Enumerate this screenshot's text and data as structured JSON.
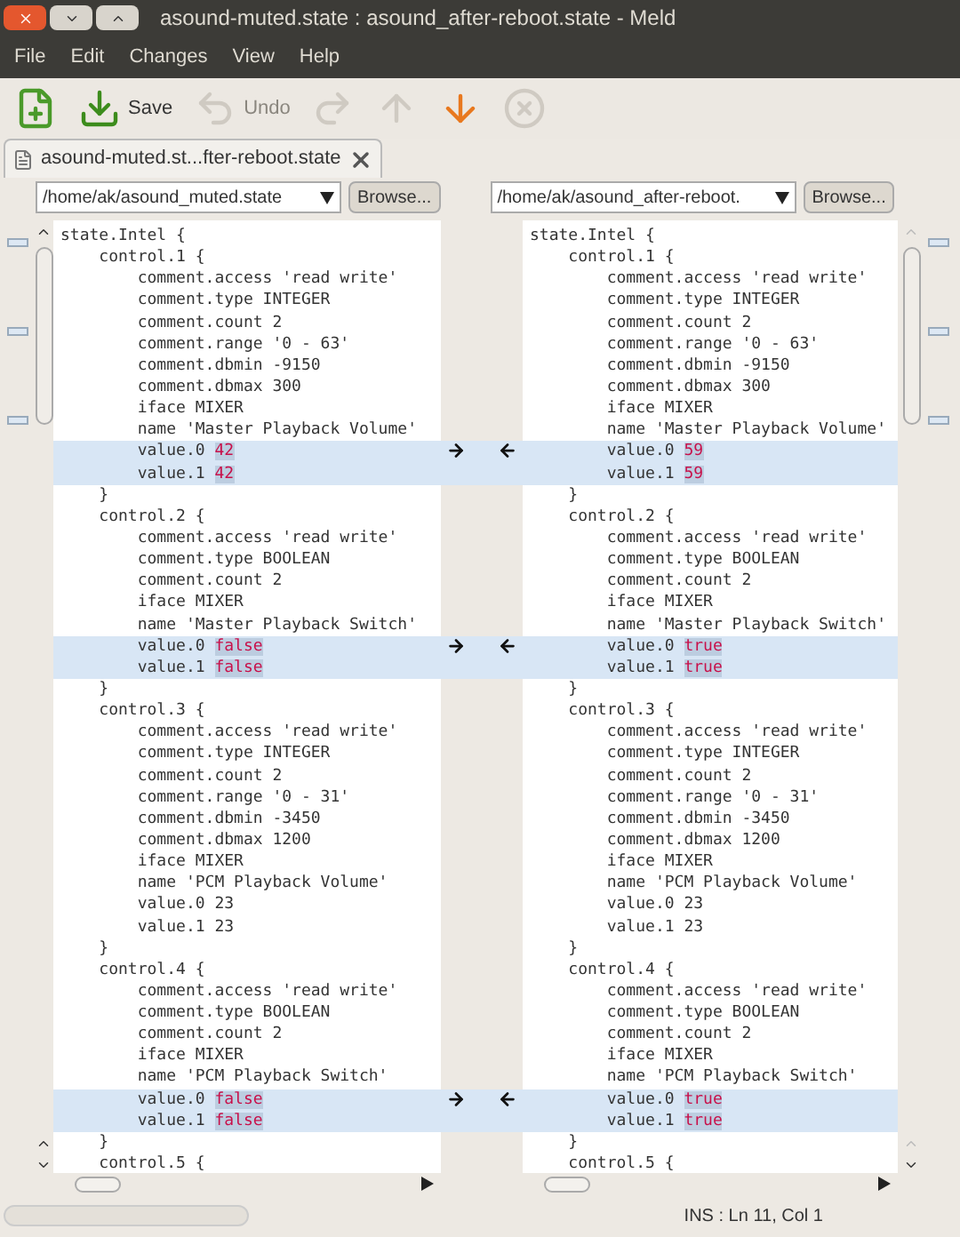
{
  "window": {
    "title": "asound-muted.state : asound_after-reboot.state - Meld"
  },
  "menu": [
    "File",
    "Edit",
    "Changes",
    "View",
    "Help"
  ],
  "toolbar": [
    {
      "kind": "new",
      "disabled": false
    },
    {
      "kind": "save",
      "label": "Save",
      "disabled": false
    },
    {
      "kind": "undo",
      "label": "Undo",
      "disabled": true
    },
    {
      "kind": "redo",
      "disabled": true
    },
    {
      "kind": "up",
      "disabled": true
    },
    {
      "kind": "down",
      "disabled": false
    },
    {
      "kind": "stop",
      "disabled": true
    }
  ],
  "tab": {
    "label": "asound-muted.st...fter-reboot.state"
  },
  "panes": [
    {
      "path": "/home/ak/asound_muted.state",
      "browse": "Browse...",
      "lines": [
        {
          "text": "state.Intel {"
        },
        {
          "text": "    control.1 {"
        },
        {
          "text": "        comment.access 'read write'"
        },
        {
          "text": "        comment.type INTEGER"
        },
        {
          "text": "        comment.count 2"
        },
        {
          "text": "        comment.range '0 - 63'"
        },
        {
          "text": "        comment.dbmin -9150"
        },
        {
          "text": "        comment.dbmax 300"
        },
        {
          "text": "        iface MIXER"
        },
        {
          "text": "        name 'Master Playback Volume'"
        },
        {
          "text": "        value.0 ",
          "diff": "42",
          "changed": true
        },
        {
          "text": "        value.1 ",
          "diff": "42",
          "changed": true
        },
        {
          "text": "    }"
        },
        {
          "text": "    control.2 {"
        },
        {
          "text": "        comment.access 'read write'"
        },
        {
          "text": "        comment.type BOOLEAN"
        },
        {
          "text": "        comment.count 2"
        },
        {
          "text": "        iface MIXER"
        },
        {
          "text": "        name 'Master Playback Switch'"
        },
        {
          "text": "        value.0 ",
          "diff": "false",
          "changed": true
        },
        {
          "text": "        value.1 ",
          "diff": "false",
          "changed": true
        },
        {
          "text": "    }"
        },
        {
          "text": "    control.3 {"
        },
        {
          "text": "        comment.access 'read write'"
        },
        {
          "text": "        comment.type INTEGER"
        },
        {
          "text": "        comment.count 2"
        },
        {
          "text": "        comment.range '0 - 31'"
        },
        {
          "text": "        comment.dbmin -3450"
        },
        {
          "text": "        comment.dbmax 1200"
        },
        {
          "text": "        iface MIXER"
        },
        {
          "text": "        name 'PCM Playback Volume'"
        },
        {
          "text": "        value.0 23"
        },
        {
          "text": "        value.1 23"
        },
        {
          "text": "    }"
        },
        {
          "text": "    control.4 {"
        },
        {
          "text": "        comment.access 'read write'"
        },
        {
          "text": "        comment.type BOOLEAN"
        },
        {
          "text": "        comment.count 2"
        },
        {
          "text": "        iface MIXER"
        },
        {
          "text": "        name 'PCM Playback Switch'"
        },
        {
          "text": "        value.0 ",
          "diff": "false",
          "changed": true
        },
        {
          "text": "        value.1 ",
          "diff": "false",
          "changed": true
        },
        {
          "text": "    }"
        },
        {
          "text": "    control.5 {"
        }
      ]
    },
    {
      "path": "/home/ak/asound_after-reboot.",
      "browse": "Browse...",
      "lines": [
        {
          "text": "state.Intel {"
        },
        {
          "text": "    control.1 {"
        },
        {
          "text": "        comment.access 'read write'"
        },
        {
          "text": "        comment.type INTEGER"
        },
        {
          "text": "        comment.count 2"
        },
        {
          "text": "        comment.range '0 - 63'"
        },
        {
          "text": "        comment.dbmin -9150"
        },
        {
          "text": "        comment.dbmax 300"
        },
        {
          "text": "        iface MIXER"
        },
        {
          "text": "        name 'Master Playback Volume'"
        },
        {
          "text": "        value.0 ",
          "diff": "59",
          "changed": true
        },
        {
          "text": "        value.1 ",
          "diff": "59",
          "changed": true
        },
        {
          "text": "    }"
        },
        {
          "text": "    control.2 {"
        },
        {
          "text": "        comment.access 'read write'"
        },
        {
          "text": "        comment.type BOOLEAN"
        },
        {
          "text": "        comment.count 2"
        },
        {
          "text": "        iface MIXER"
        },
        {
          "text": "        name 'Master Playback Switch'"
        },
        {
          "text": "        value.0 ",
          "diff": "true",
          "changed": true
        },
        {
          "text": "        value.1 ",
          "diff": "true",
          "changed": true
        },
        {
          "text": "    }"
        },
        {
          "text": "    control.3 {"
        },
        {
          "text": "        comment.access 'read write'"
        },
        {
          "text": "        comment.type INTEGER"
        },
        {
          "text": "        comment.count 2"
        },
        {
          "text": "        comment.range '0 - 31'"
        },
        {
          "text": "        comment.dbmin -3450"
        },
        {
          "text": "        comment.dbmax 1200"
        },
        {
          "text": "        iface MIXER"
        },
        {
          "text": "        name 'PCM Playback Volume'"
        },
        {
          "text": "        value.0 23"
        },
        {
          "text": "        value.1 23"
        },
        {
          "text": "    }"
        },
        {
          "text": "    control.4 {"
        },
        {
          "text": "        comment.access 'read write'"
        },
        {
          "text": "        comment.type BOOLEAN"
        },
        {
          "text": "        comment.count 2"
        },
        {
          "text": "        iface MIXER"
        },
        {
          "text": "        name 'PCM Playback Switch'"
        },
        {
          "text": "        value.0 ",
          "diff": "true",
          "changed": true
        },
        {
          "text": "        value.1 ",
          "diff": "true",
          "changed": true
        },
        {
          "text": "    }"
        },
        {
          "text": "    control.5 {"
        }
      ]
    }
  ],
  "status_bar": {
    "text": "INS : Ln 11, Col 1"
  }
}
